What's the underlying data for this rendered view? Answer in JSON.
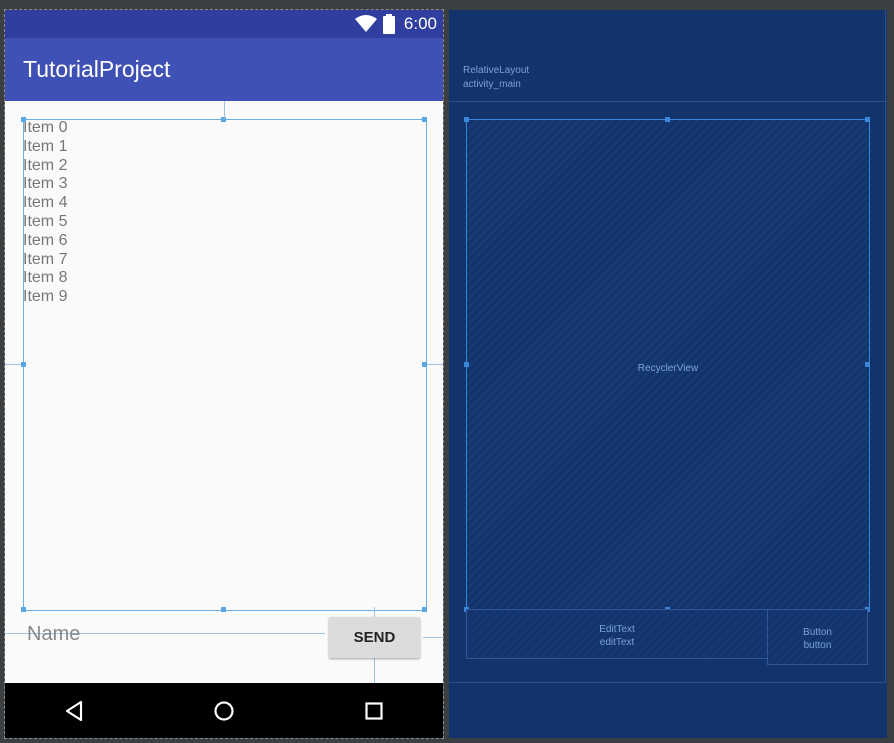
{
  "phone": {
    "status_time": "6:00",
    "app_title": "TutorialProject",
    "list_items": [
      "Item 0",
      "Item 1",
      "Item 2",
      "Item 3",
      "Item 4",
      "Item 5",
      "Item 6",
      "Item 7",
      "Item 8",
      "Item 9"
    ],
    "edit_text_hint": "Name",
    "send_label": "SEND",
    "nav": {
      "back_icon": "back-triangle-icon",
      "home_icon": "home-circle-icon",
      "recents_icon": "recents-square-icon"
    }
  },
  "blueprint": {
    "root_type": "RelativeLayout",
    "root_id": "activity_main",
    "recycler_label": "RecyclerView",
    "edittext_type": "EditText",
    "edittext_id": "editText",
    "button_type": "Button",
    "button_id": "button"
  },
  "colors": {
    "status_bar": "#303f9f",
    "app_bar": "#3f51b5",
    "blueprint_bg": "#12336b",
    "selection": "#5aa7e6"
  }
}
